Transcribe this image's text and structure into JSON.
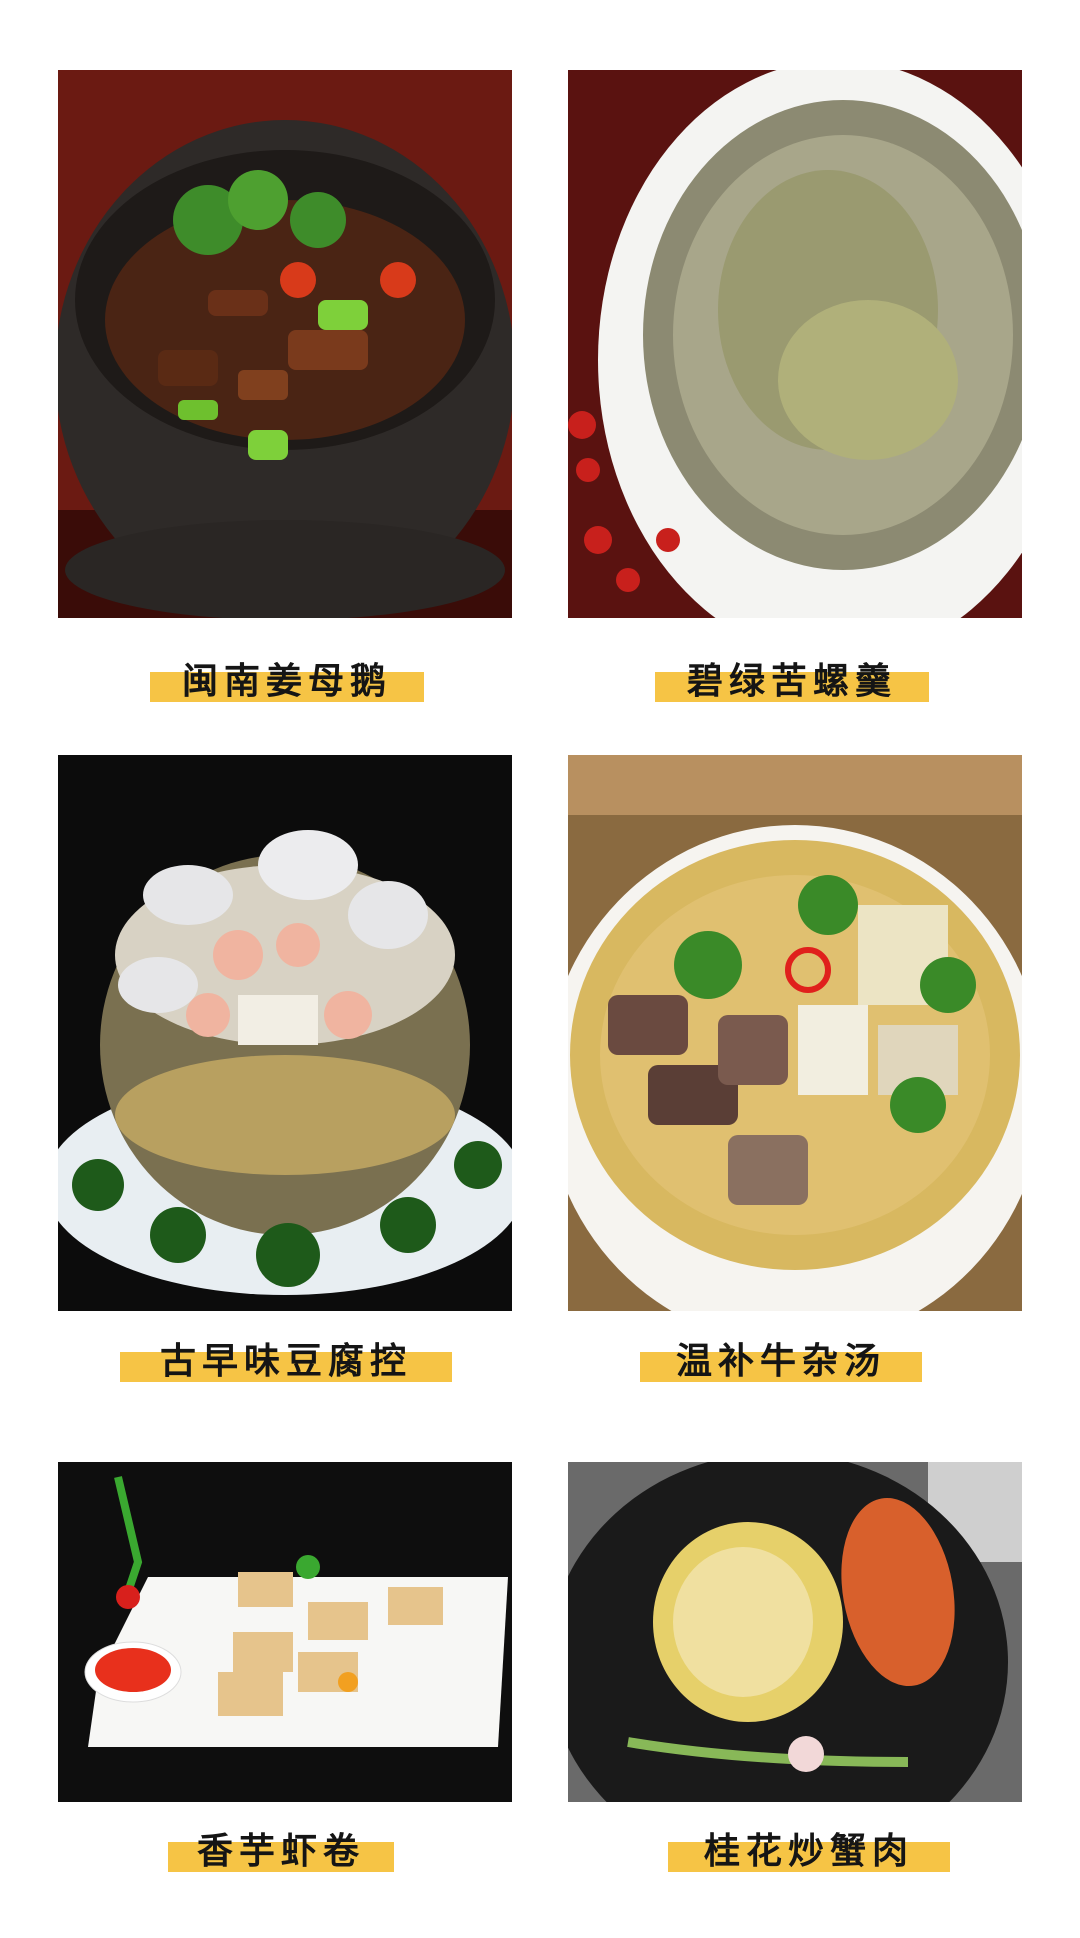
{
  "dishes": [
    {
      "name": "闽南姜母鹅",
      "image": "ginger-goose-claypot-photo"
    },
    {
      "name": "碧绿苦螺羹",
      "image": "green-snail-soup-photo"
    },
    {
      "name": "古早味豆腐控",
      "image": "seafood-tofu-pot-photo"
    },
    {
      "name": "温补牛杂汤",
      "image": "beef-offal-soup-photo"
    },
    {
      "name": "香芋虾卷",
      "image": "taro-shrimp-roll-photo"
    },
    {
      "name": "桂花炒蟹肉",
      "image": "osmanthus-crab-meat-photo"
    }
  ],
  "colors": {
    "highlight": "#f6c445",
    "caption_text": "#151515"
  }
}
